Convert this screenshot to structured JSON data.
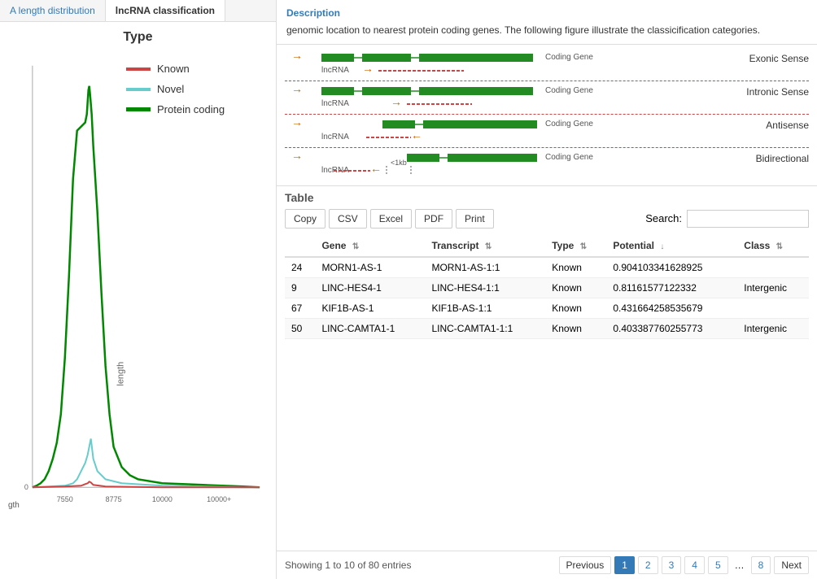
{
  "tabs": [
    {
      "id": "length",
      "label": "A length distribution",
      "active": false
    },
    {
      "id": "lncrna",
      "label": "lncRNA classification",
      "active": true
    }
  ],
  "chart": {
    "title": "Type",
    "legend": [
      {
        "id": "known",
        "label": "Known",
        "class": "known"
      },
      {
        "id": "novel",
        "label": "Novel",
        "class": "novel"
      },
      {
        "id": "protein",
        "label": "Protein coding",
        "class": "protein"
      }
    ],
    "xLabels": [
      "7550",
      "8775",
      "10000",
      "10000+"
    ],
    "yLabel": "gth"
  },
  "description": {
    "title": "Description",
    "text": "genomic location to nearest protein coding genes. The following figure illustrate the classicification categories."
  },
  "diagrams": [
    {
      "id": "exonic",
      "rightLabel": "Exonic Sense",
      "geneLabel": "Coding Gene",
      "lncLabel": "lncRNA"
    },
    {
      "id": "intronic",
      "rightLabel": "Intronic Sense",
      "geneLabel": "Coding Gene",
      "lncLabel": "lncRNA"
    },
    {
      "id": "antisense",
      "rightLabel": "Antisense",
      "geneLabel": "Coding Gene",
      "lncLabel": "lncRNA"
    },
    {
      "id": "bidirectional",
      "rightLabel": "Bidirectional",
      "geneLabel": "Coding Gene",
      "lncLabel": "lncRNA",
      "distLabel": "<1kb"
    }
  ],
  "table": {
    "title": "Table",
    "buttons": [
      "Copy",
      "CSV",
      "Excel",
      "PDF",
      "Print"
    ],
    "searchLabel": "Search:",
    "searchPlaceholder": "",
    "columns": [
      {
        "id": "num",
        "label": ""
      },
      {
        "id": "gene",
        "label": "Gene",
        "sortable": true
      },
      {
        "id": "transcript",
        "label": "Transcript",
        "sortable": true
      },
      {
        "id": "type",
        "label": "Type",
        "sortable": true
      },
      {
        "id": "potential",
        "label": "Potential",
        "sortable": true
      },
      {
        "id": "class",
        "label": "Class",
        "sortable": true
      }
    ],
    "rows": [
      {
        "num": "24",
        "gene": "MORN1-AS-1",
        "transcript": "MORN1-AS-1:1",
        "type": "Known",
        "potential": "0.904103341628925",
        "class": ""
      },
      {
        "num": "9",
        "gene": "LINC-HES4-1",
        "transcript": "LINC-HES4-1:1",
        "type": "Known",
        "potential": "0.81161577122332",
        "class": "Intergenic"
      },
      {
        "num": "67",
        "gene": "KIF1B-AS-1",
        "transcript": "KIF1B-AS-1:1",
        "type": "Known",
        "potential": "0.431664258535679",
        "class": ""
      },
      {
        "num": "50",
        "gene": "LINC-CAMTA1-1",
        "transcript": "LINC-CAMTA1-1:1",
        "type": "Known",
        "potential": "0.403387760255773",
        "class": "Intergenic"
      }
    ],
    "showingText": "Showing 1 to 10 of 80 entries"
  },
  "pagination": {
    "prevLabel": "Previous",
    "nextLabel": "Next",
    "ellipsis": "…",
    "pages": [
      "1",
      "2",
      "3",
      "4",
      "5",
      "8"
    ],
    "activePage": "1"
  }
}
